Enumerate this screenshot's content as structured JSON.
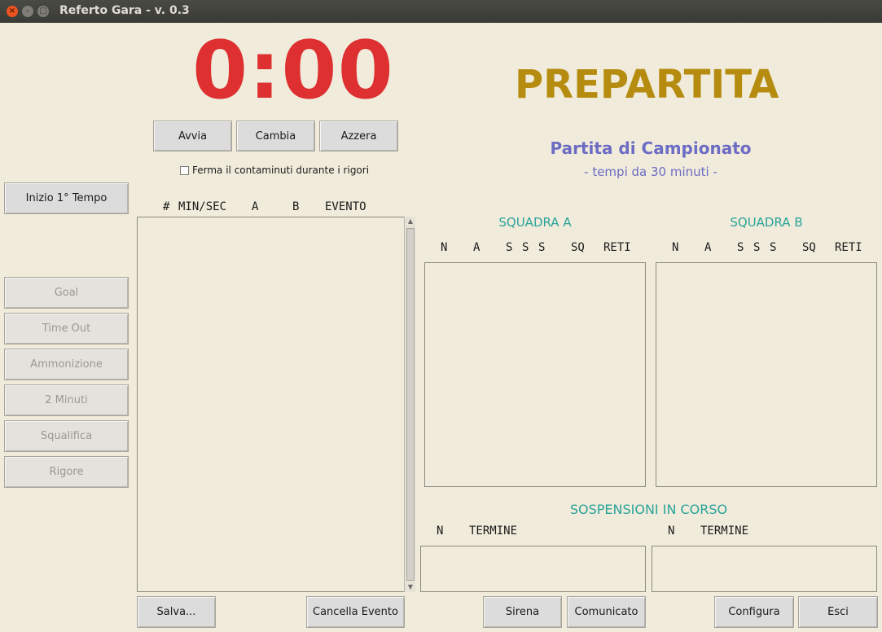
{
  "window": {
    "title": "Referto Gara - v. 0.3"
  },
  "timer": {
    "display": "0:00",
    "start_label": "Avvia",
    "change_label": "Cambia",
    "reset_label": "Azzera",
    "stop_on_penalties_label": "Ferma il contaminuti durante i rigori",
    "stop_on_penalties_checked": false
  },
  "status": {
    "phase": "PREPARTITA",
    "match_type": "Partita di Campionato",
    "period_info": "- tempi da 30 minuti -"
  },
  "sidebar": {
    "start_period_label": "Inizio 1° Tempo",
    "events": [
      {
        "label": "Goal",
        "enabled": false
      },
      {
        "label": "Time Out",
        "enabled": false
      },
      {
        "label": "Ammonizione",
        "enabled": false
      },
      {
        "label": "2 Minuti",
        "enabled": false
      },
      {
        "label": "Squalifica",
        "enabled": false
      },
      {
        "label": "Rigore",
        "enabled": false
      }
    ]
  },
  "event_log": {
    "headers": [
      "#",
      "MIN/SEC",
      "A",
      "B",
      "EVENTO"
    ],
    "rows": []
  },
  "teams": {
    "a": {
      "title": "SQUADRA A",
      "headers": [
        "N",
        "A",
        "S",
        "S",
        "S",
        "SQ",
        "RETI"
      ],
      "rows": []
    },
    "b": {
      "title": "SQUADRA B",
      "headers": [
        "N",
        "A",
        "S",
        "S",
        "S",
        "SQ",
        "RETI"
      ],
      "rows": []
    }
  },
  "suspensions": {
    "title": "SOSPENSIONI IN CORSO",
    "headers": [
      "N",
      "TERMINE"
    ]
  },
  "footer": {
    "save_label": "Salva...",
    "delete_event_label": "Cancella Evento",
    "siren_label": "Sirena",
    "announcement_label": "Comunicato",
    "configure_label": "Configura",
    "exit_label": "Esci"
  },
  "colors": {
    "background": "#f0ebdb",
    "timer": "#de3030",
    "phase": "#b68c10",
    "match_info": "#6d6cc4",
    "section_titles": "#2aa39a"
  }
}
